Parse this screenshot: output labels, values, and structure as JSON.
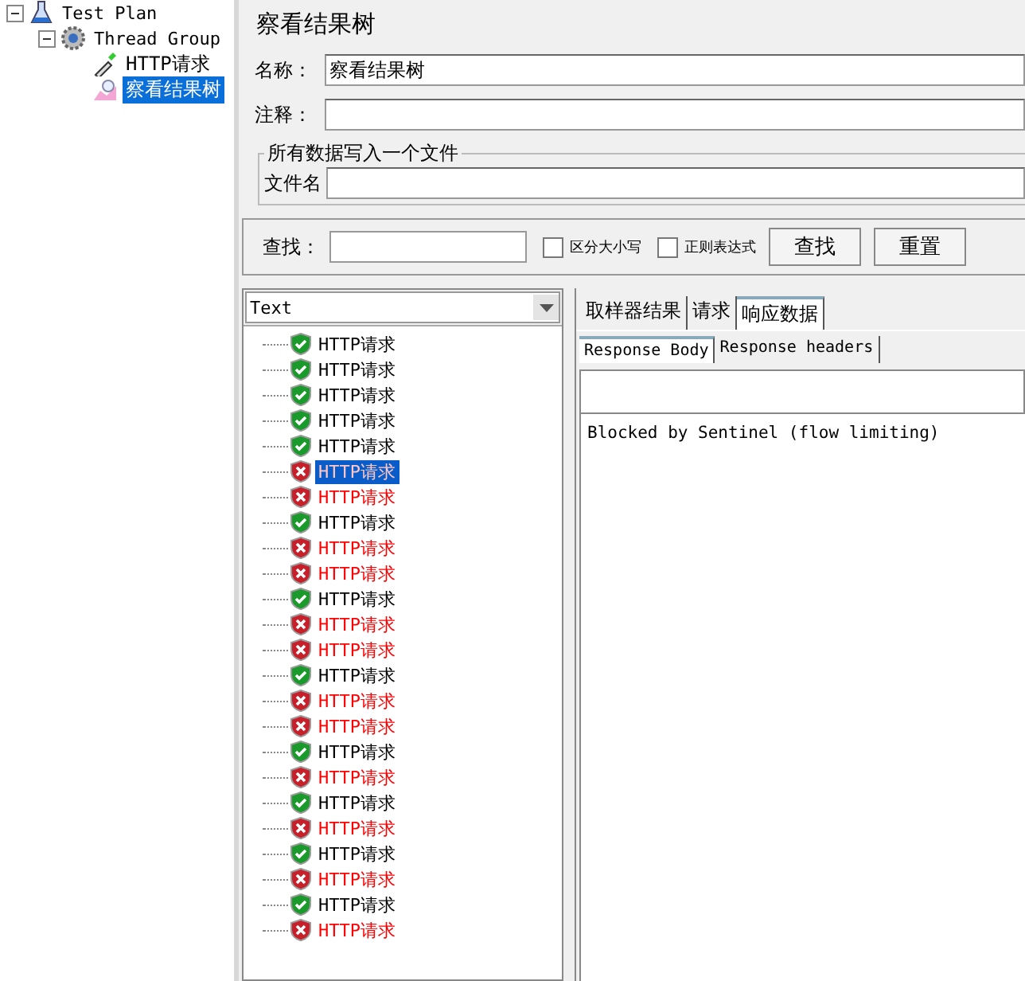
{
  "tree": [
    {
      "label": "Test Plan",
      "kind": "plan",
      "expanded": true,
      "selected": false,
      "children": [
        {
          "label": "Thread Group",
          "kind": "group",
          "expanded": true,
          "selected": false,
          "children": [
            {
              "label": "HTTP请求",
              "kind": "sampler",
              "selected": false
            },
            {
              "label": "察看结果树",
              "kind": "listener",
              "selected": true
            }
          ]
        }
      ]
    }
  ],
  "title": "察看结果树",
  "name_field": {
    "label": "名称：",
    "value": "察看结果树"
  },
  "comment_field": {
    "label": "注释："
  },
  "file_group": {
    "title": "所有数据写入一个文件",
    "label": "文件名"
  },
  "search": {
    "label": "查找：",
    "checkboxes": [
      {
        "label": "区分大小写",
        "checked": false
      },
      {
        "label": "正则表达式",
        "checked": false
      }
    ],
    "buttons": [
      "查找",
      "重置"
    ]
  },
  "renderer": {
    "value": "Text"
  },
  "results": [
    {
      "label": "HTTP请求",
      "ok": true,
      "selected": false
    },
    {
      "label": "HTTP请求",
      "ok": true,
      "selected": false
    },
    {
      "label": "HTTP请求",
      "ok": true,
      "selected": false
    },
    {
      "label": "HTTP请求",
      "ok": true,
      "selected": false
    },
    {
      "label": "HTTP请求",
      "ok": true,
      "selected": false
    },
    {
      "label": "HTTP请求",
      "ok": false,
      "selected": true
    },
    {
      "label": "HTTP请求",
      "ok": false,
      "selected": false
    },
    {
      "label": "HTTP请求",
      "ok": true,
      "selected": false
    },
    {
      "label": "HTTP请求",
      "ok": false,
      "selected": false
    },
    {
      "label": "HTTP请求",
      "ok": false,
      "selected": false
    },
    {
      "label": "HTTP请求",
      "ok": true,
      "selected": false
    },
    {
      "label": "HTTP请求",
      "ok": false,
      "selected": false
    },
    {
      "label": "HTTP请求",
      "ok": false,
      "selected": false
    },
    {
      "label": "HTTP请求",
      "ok": true,
      "selected": false
    },
    {
      "label": "HTTP请求",
      "ok": false,
      "selected": false
    },
    {
      "label": "HTTP请求",
      "ok": false,
      "selected": false
    },
    {
      "label": "HTTP请求",
      "ok": true,
      "selected": false
    },
    {
      "label": "HTTP请求",
      "ok": false,
      "selected": false
    },
    {
      "label": "HTTP请求",
      "ok": true,
      "selected": false
    },
    {
      "label": "HTTP请求",
      "ok": false,
      "selected": false
    },
    {
      "label": "HTTP请求",
      "ok": true,
      "selected": false
    },
    {
      "label": "HTTP请求",
      "ok": false,
      "selected": false
    },
    {
      "label": "HTTP请求",
      "ok": true,
      "selected": false
    },
    {
      "label": "HTTP请求",
      "ok": false,
      "selected": false
    }
  ],
  "tabs": [
    {
      "label": "取样器结果",
      "selected": false
    },
    {
      "label": "请求",
      "selected": false
    },
    {
      "label": "响应数据",
      "selected": true
    }
  ],
  "subtabs": [
    {
      "label": "Response Body",
      "selected": true
    },
    {
      "label": "Response headers",
      "selected": false
    }
  ],
  "response_text": "Blocked by Sentinel (flow limiting)"
}
